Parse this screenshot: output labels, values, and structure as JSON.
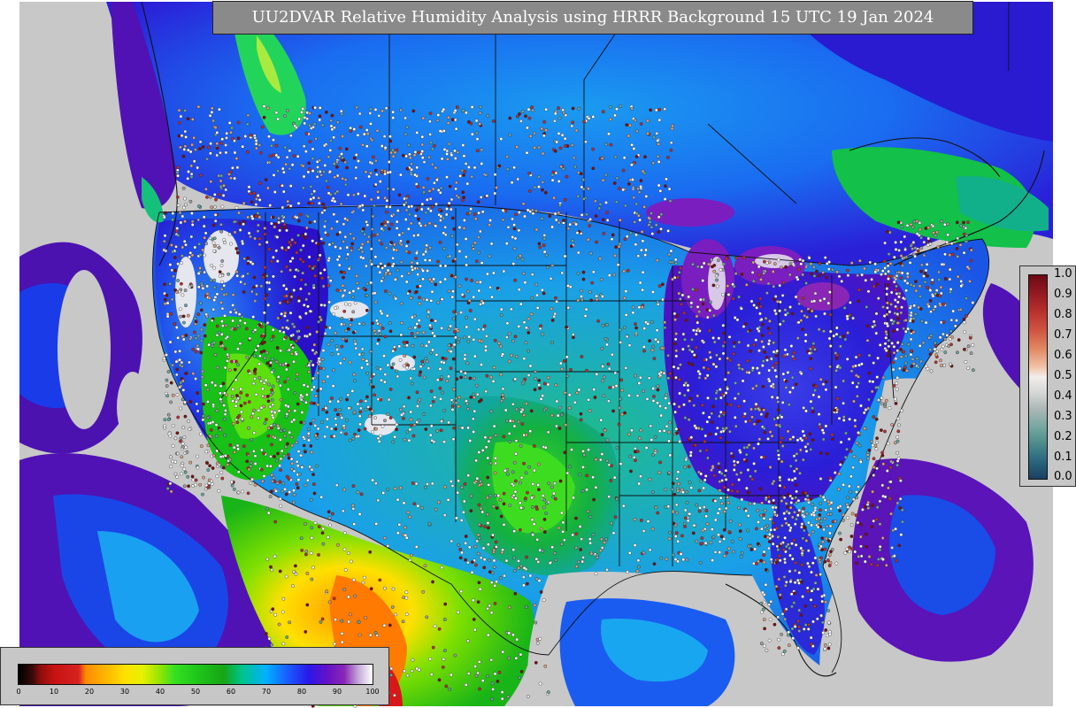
{
  "title": "UU2DVAR Relative Humidity Analysis using HRRR Background 15 UTC 19 Jan 2024",
  "colorbar_rh": {
    "tick_labels": [
      "0",
      "10",
      "20",
      "30",
      "40",
      "50",
      "60",
      "70",
      "80",
      "90",
      "100"
    ],
    "min": 0,
    "max": 100
  },
  "colorbar_obs": {
    "tick_labels": [
      "1.0",
      "0.9",
      "0.8",
      "0.7",
      "0.6",
      "0.5",
      "0.4",
      "0.3",
      "0.2",
      "0.1",
      "0.0"
    ],
    "min": 0.0,
    "max": 1.0
  },
  "colors": {
    "title_bg": "#8a8a8a",
    "legend_bg": "#c7c7c7",
    "ocean_gray": "#c8c8c8",
    "border_line": "#111111"
  },
  "icons": {
    "map": "rh-analysis-map",
    "observations": "station-dot-markers"
  }
}
